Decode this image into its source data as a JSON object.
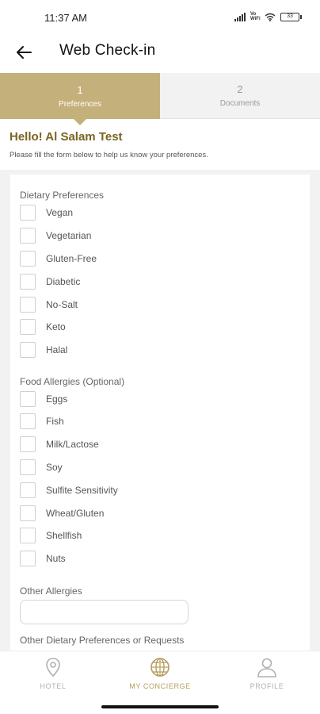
{
  "status_bar": {
    "time": "11:37 AM",
    "network": "Vo WiFi",
    "battery": "33"
  },
  "header": {
    "title": "Web Check-in",
    "back_icon": "arrow-left-icon"
  },
  "steps": [
    {
      "number": "1",
      "label": "Preferences",
      "active": true
    },
    {
      "number": "2",
      "label": "Documents",
      "active": false
    }
  ],
  "greeting": {
    "title": "Hello! Al Salam Test",
    "subtitle": "Please fill the form below to help us know your preferences."
  },
  "dietary": {
    "label": "Dietary Preferences",
    "options": [
      "Vegan",
      "Vegetarian",
      "Gluten-Free",
      "Diabetic",
      "No-Salt",
      "Keto",
      "Halal"
    ]
  },
  "allergies": {
    "label": "Food Allergies (Optional)",
    "options": [
      "Eggs",
      "Fish",
      "Milk/Lactose",
      "Soy",
      "Sulfite Sensitivity",
      "Wheat/Gluten",
      "Shellfish",
      "Nuts"
    ]
  },
  "other_allergies": {
    "label": "Other Allergies",
    "value": "",
    "placeholder": ""
  },
  "other_requests": {
    "label": "Other Dietary Preferences or Requests"
  },
  "bottom_nav": [
    {
      "label": "HOTEL",
      "icon": "location-pin-icon",
      "active": false
    },
    {
      "label": "MY CONCIERGE",
      "icon": "globe-icon",
      "active": true
    },
    {
      "label": "PROFILE",
      "icon": "user-icon",
      "active": false
    }
  ],
  "colors": {
    "accent": "#c4b07a",
    "greeting_text": "#7a6420",
    "nav_active": "#b59d5e",
    "nav_inactive": "#b0b0b0"
  }
}
